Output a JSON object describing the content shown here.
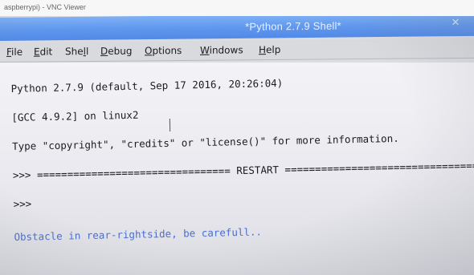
{
  "vnc": {
    "title": "aspberrypi) - VNC Viewer"
  },
  "window": {
    "title": "*Python 2.7.9 Shell*",
    "close_glyph": "✕"
  },
  "menu": {
    "items": [
      {
        "mnemonic": "F",
        "rest": "ile"
      },
      {
        "mnemonic": "E",
        "rest": "dit"
      },
      {
        "prefix": "She",
        "mnemonic": "l",
        "rest": "l"
      },
      {
        "mnemonic": "D",
        "rest": "ebug"
      },
      {
        "mnemonic": "O",
        "rest": "ptions"
      },
      {
        "mnemonic": "W",
        "rest": "indows"
      },
      {
        "mnemonic": "H",
        "rest": "elp"
      }
    ]
  },
  "shell": {
    "lines": [
      "Python 2.7.9 (default, Sep 17 2016, 20:26:04)",
      "[GCC 4.9.2] on linux2",
      "Type \"copyright\", \"credits\" or \"license()\" for more information.",
      ">>> ================================ RESTART ================================",
      ">>> "
    ],
    "output": "Obstacle in rear-rightside, be carefull.."
  },
  "colors": {
    "title_bar": "#5f97ee",
    "output_text": "#4a6fd0",
    "menu_bg": "#d9dade"
  }
}
